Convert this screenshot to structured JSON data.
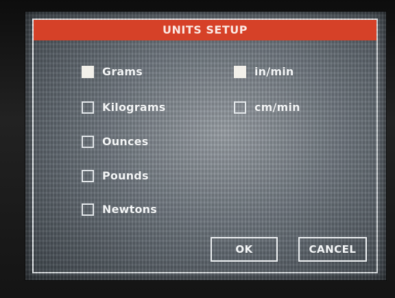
{
  "dialog": {
    "title": "UNITS SETUP"
  },
  "force_units": [
    {
      "label": "Grams",
      "checked": true
    },
    {
      "label": "Kilograms",
      "checked": false
    },
    {
      "label": "Ounces",
      "checked": false
    },
    {
      "label": "Pounds",
      "checked": false
    },
    {
      "label": "Newtons",
      "checked": false
    }
  ],
  "speed_units": [
    {
      "label": "in/min",
      "checked": true
    },
    {
      "label": "cm/min",
      "checked": false
    }
  ],
  "buttons": {
    "ok_label": "OK",
    "cancel_label": "CANCEL"
  },
  "colors": {
    "title_bar": "#d64128",
    "checked_fill": "#f2f0ea"
  }
}
